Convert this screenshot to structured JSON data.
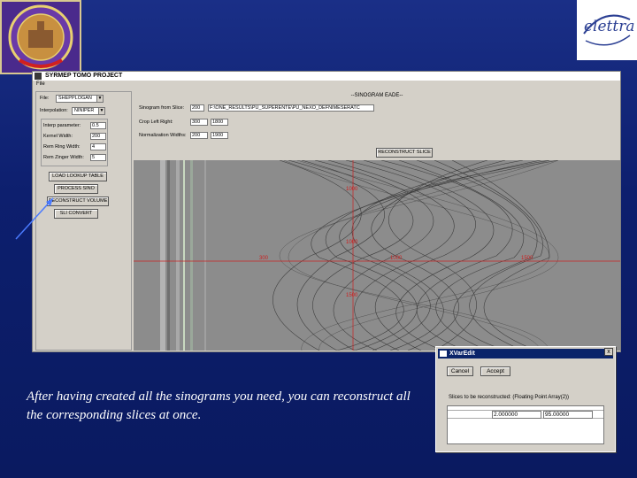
{
  "window": {
    "title": "SYRMEP TOMO PROJECT",
    "menu": "File"
  },
  "left_panel": {
    "file_label": "File:",
    "file_value": "SHEPPLOGAN",
    "interpolation_label": "Interpolation:",
    "interpolation_value": "NINIPER",
    "params": [
      {
        "label": "Interp parameter:",
        "value": "0.5"
      },
      {
        "label": "Kernel Width:",
        "value": "200"
      },
      {
        "label": "Rem Ring Width:",
        "value": "4"
      },
      {
        "label": "Rem Zinger Width:",
        "value": "5"
      }
    ],
    "buttons": [
      "LOAD LOOKUP TABLE",
      "PROCESS SINO",
      "RECONSTRUCT VOLUME",
      "SLI CONVERT"
    ]
  },
  "right_panel": {
    "section_title": "--SINOGRAM EADE--",
    "sino_from_slice_label": "Sinogram from Slice:",
    "sino_from_slice_value": "200",
    "sino_path": "F:\\ONE_RESULTS\\PU_SUPERENTE\\PU_NEXO_DEFNIMESERATC",
    "crop_label": "Crop Left Right:",
    "crop_left": "300",
    "crop_right": "1800",
    "norm_label": "Normalization Widths:",
    "norm_a": "200",
    "norm_b": "1900",
    "reconstruct_button": "RECONSTRUCT SLICE",
    "axis_labels": {
      "left": "300",
      "center": "1000",
      "right": "1500",
      "top": "1000",
      "bottom": "1500",
      "middle": "1000"
    }
  },
  "dialog": {
    "title": "XVarEdit",
    "close": "x",
    "cancel_label": "Cancel",
    "accept_label": "Accept",
    "prompt": "Slices to be reconstructed: (Floating Point Array(2))",
    "value1": "2.000000",
    "value2": "95.00000"
  },
  "logos": {
    "right_text": "elettra"
  },
  "caption": "After having created all the sinograms you need, you can reconstruct all the corresponding slices at once.",
  "colors": {
    "background": "#14267a",
    "arrow": "#4a7aff",
    "sino_axis": "#cc2020"
  }
}
